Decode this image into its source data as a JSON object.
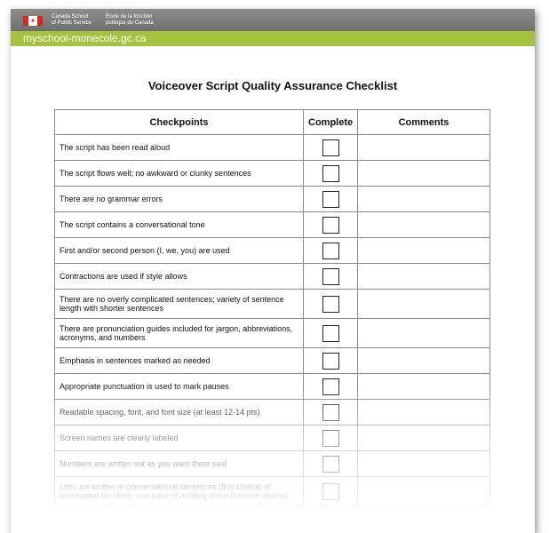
{
  "header": {
    "org_en_line1": "Canada School",
    "org_en_line2": "of Public Service",
    "org_fr_line1": "École de la fonction",
    "org_fr_line2": "publique du Canada",
    "url": "myschool-monecole.gc.ca"
  },
  "document": {
    "title": "Voiceover Script Quality Assurance Checklist",
    "columns": [
      "Checkpoints",
      "Complete",
      "Comments"
    ],
    "rows": [
      "The script has been read aloud",
      "The script flows well; no awkward or clunky sentences",
      "There are no grammar errors",
      "The script contains a conversational tone",
      "First and/or second person (I, we, you) are used",
      "Contractions are used if style allows",
      "There are no overly complicated sentences; variety of sentence length with shorter sentences",
      "There are pronunciation guides included for jargon, abbreviations, acronyms, and numbers",
      "Emphasis in sentences marked as needed",
      "Appropriate punctuation is used to mark pauses",
      "Readable spacing, font, and font size (at least 12-14 pts)",
      "Screen names are clearly labeled",
      "Numbers are written out as you want them said",
      "Lists are written in conversational sentences (first choice) or punctuated for clarity and ease of reading aloud (second choice)"
    ]
  }
}
